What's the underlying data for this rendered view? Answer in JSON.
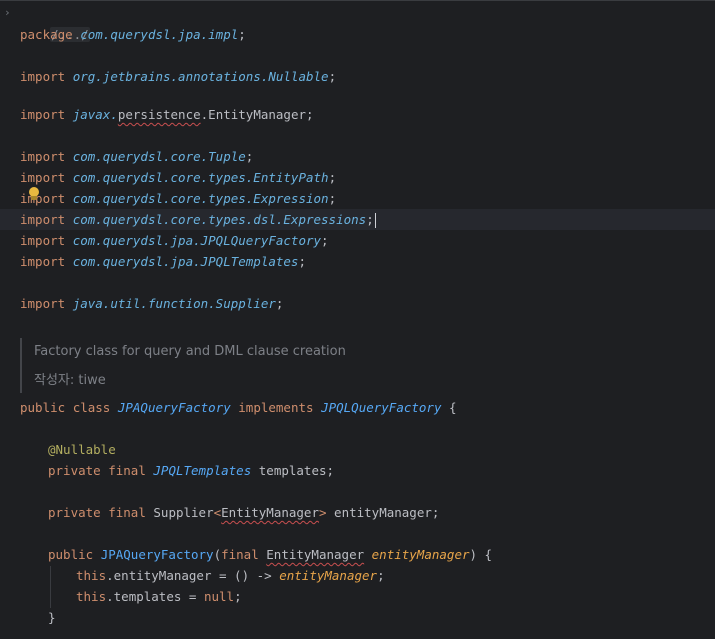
{
  "editor": {
    "folded_header": "/.../",
    "package_line": {
      "keyword": "package",
      "name": "com.querydsl.jpa.impl",
      "semi": ";"
    },
    "imports": {
      "kw": "import",
      "nullable": {
        "pkg": "org.jetbrains.annotations.",
        "cls": "Nullable"
      },
      "persistence": {
        "pkg1": "javax.",
        "pkg2": "persistence",
        "dot": ".",
        "cls": "EntityManager"
      },
      "tuple": "com.querydsl.core.Tuple",
      "entity_path": "com.querydsl.core.types.EntityPath",
      "expression": "com.querydsl.core.types.Expression",
      "expressions": "com.querydsl.core.types.dsl.Expressions",
      "jpql_factory": "com.querydsl.jpa.JPQLQueryFactory",
      "jpql_templates": "com.querydsl.jpa.JPQLTemplates",
      "supplier": "java.util.function.Supplier",
      "semi": ";"
    },
    "doc": {
      "line1": "Factory class for query and DML clause creation",
      "line2": "작성자: tiwe"
    },
    "class_decl": {
      "public": "public",
      "class": "class",
      "name": "JPAQueryFactory",
      "implements": "implements",
      "iface": "JPQLQueryFactory",
      "brace": "{"
    },
    "field1": {
      "annotation": "@Nullable",
      "private": "private",
      "final": "final",
      "type": "JPQLTemplates",
      "name": "templates",
      "semi": ";"
    },
    "field2": {
      "private": "private",
      "final": "final",
      "type": "Supplier",
      "lt": "<",
      "generic": "EntityManager",
      "gt": ">",
      "name": "entityManager",
      "semi": ";"
    },
    "ctor": {
      "public": "public",
      "name": "JPAQueryFactory",
      "lparen": "(",
      "final": "final",
      "ptype": "EntityManager",
      "pname": "entityManager",
      "rparen": ") {",
      "s1_this": "this",
      "s1_dot": ".",
      "s1_field": "entityManager",
      "s1_op": " = () -> ",
      "s1_val": "entityManager",
      "s1_semi": ";",
      "s2_this": "this",
      "s2_dot": ".",
      "s2_field": "templates",
      "s2_op": " = ",
      "s2_val": "null",
      "s2_semi": ";",
      "close": "}"
    }
  },
  "colors": {
    "background": "#1e1f22",
    "keyword": "#cf8e6d",
    "package": "#6ab2df",
    "annotation": "#b3ae60",
    "field": "#c77dbb",
    "parameter": "#e8a54a",
    "function": "#56a8f5"
  },
  "icons": {
    "fold": "chevron-right-icon",
    "intention": "lightbulb-icon"
  }
}
